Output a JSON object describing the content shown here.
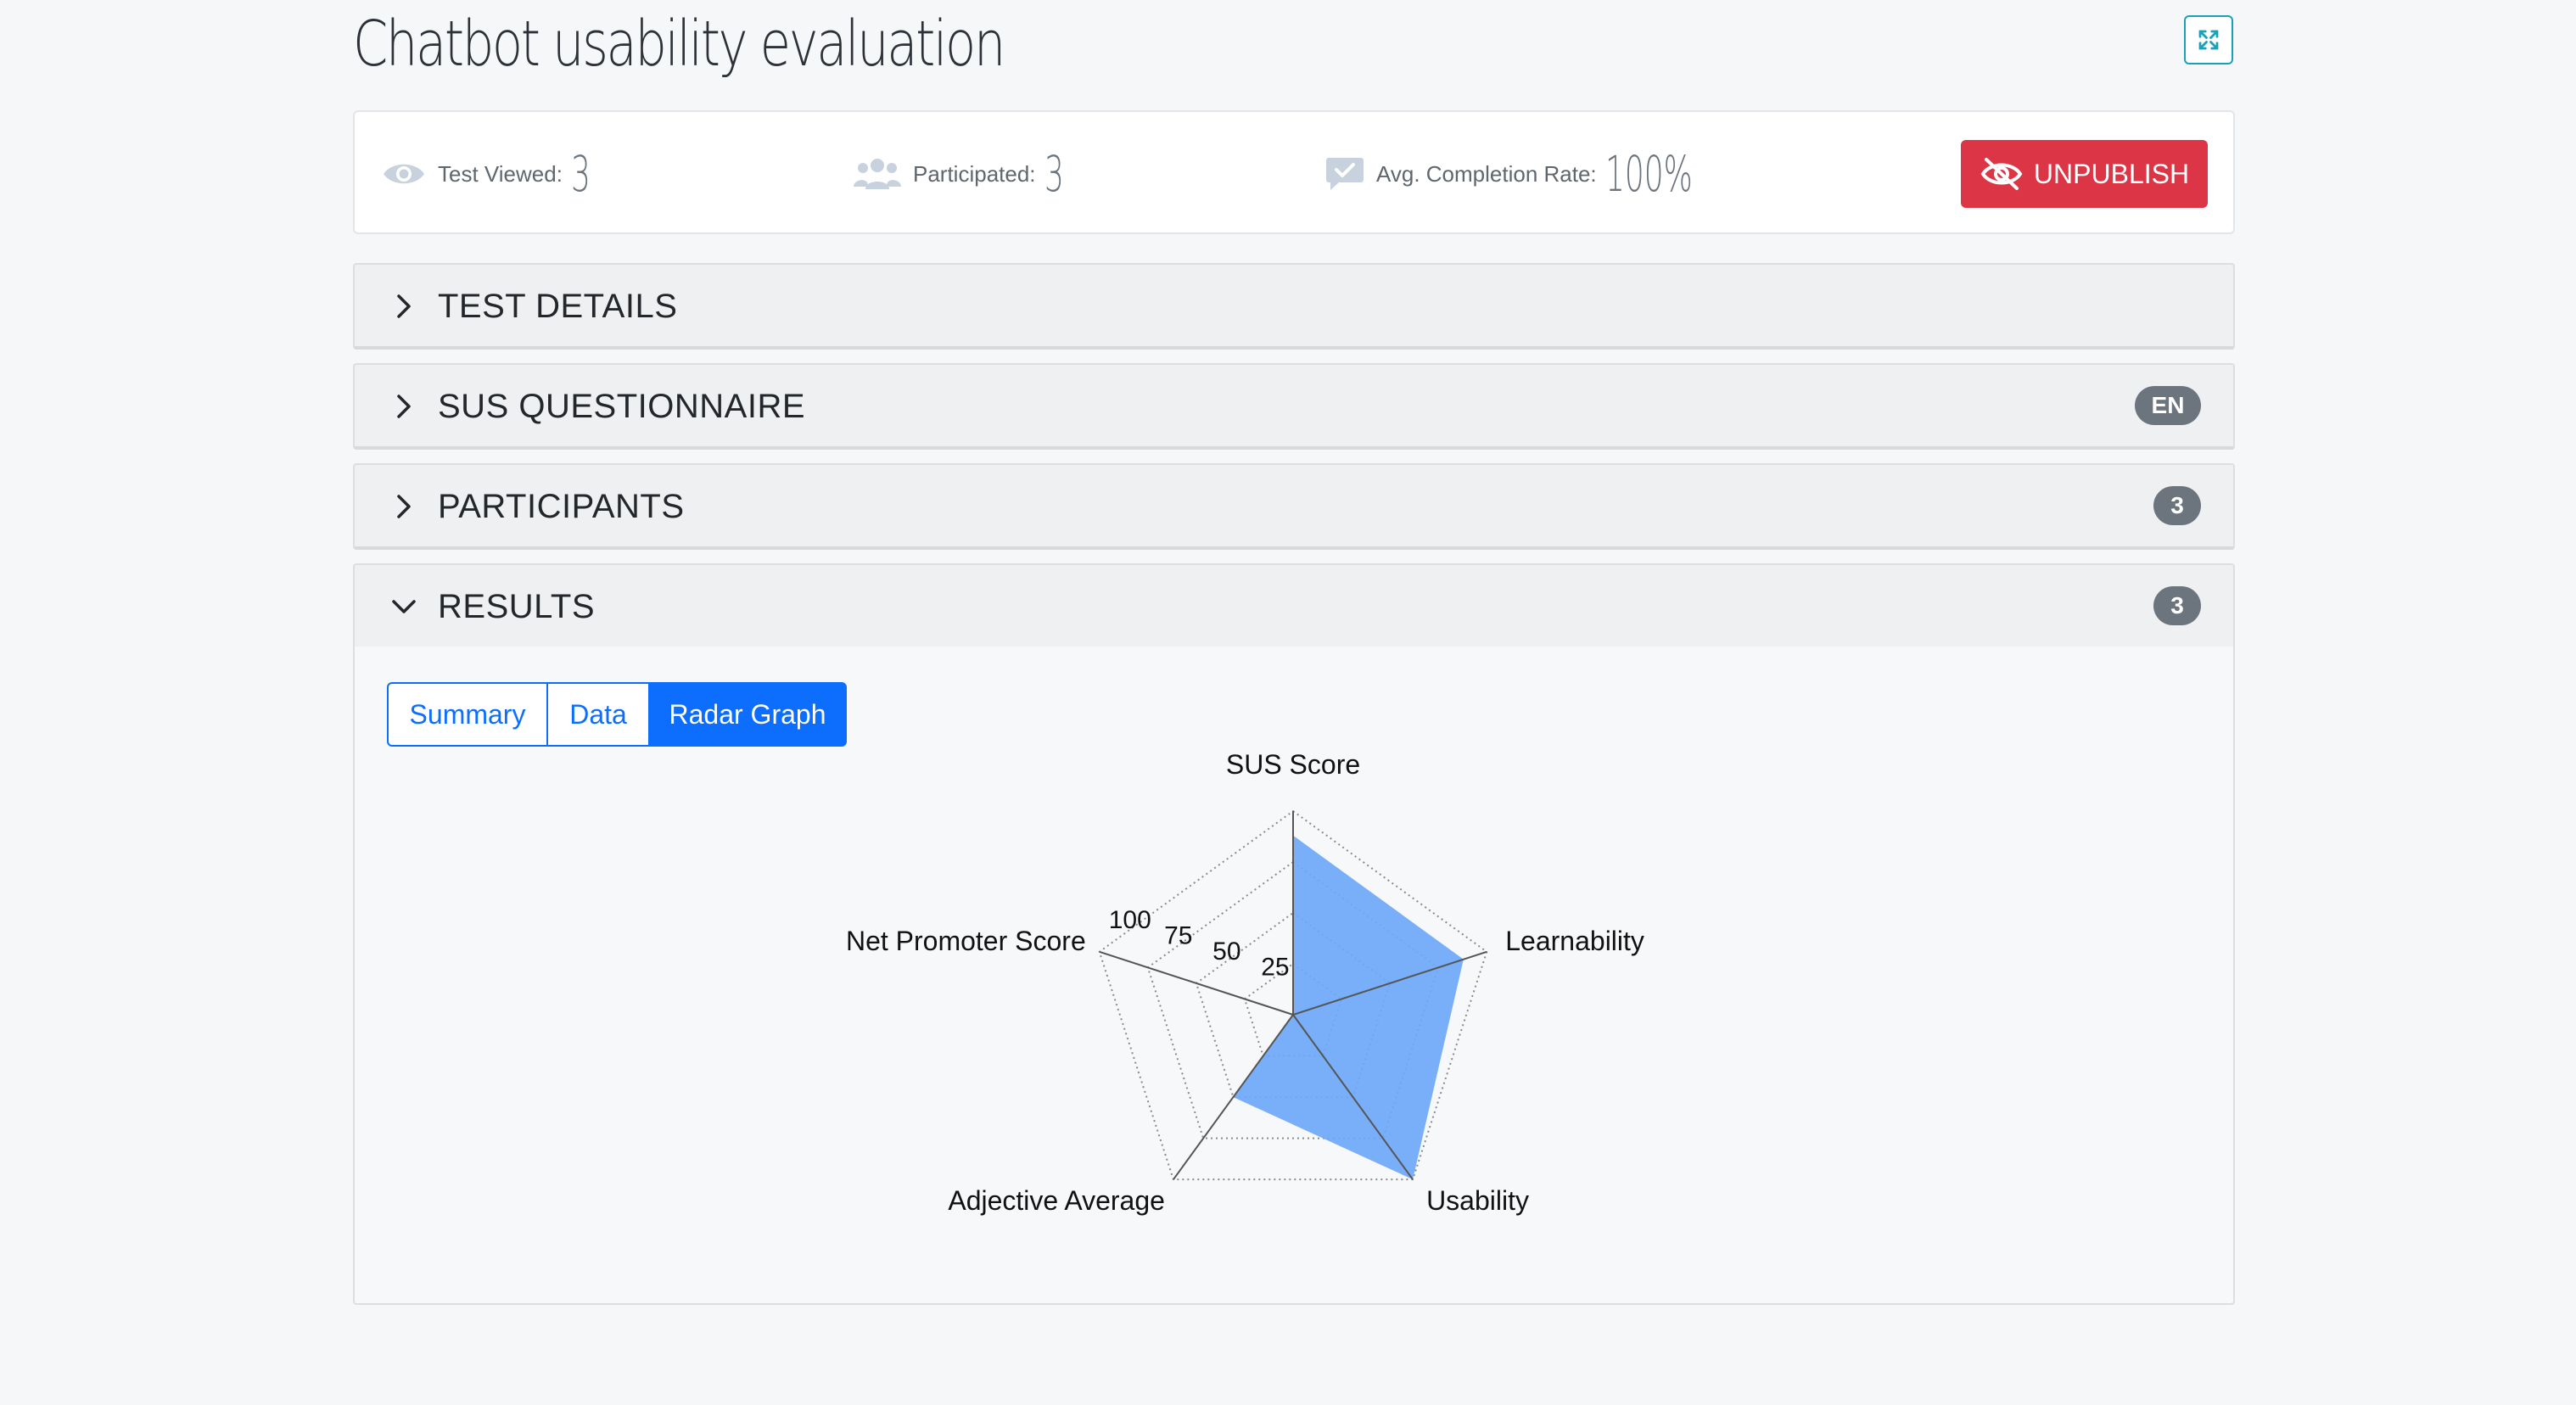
{
  "page": {
    "title": "Chatbot usability evaluation"
  },
  "stats": {
    "viewed_label": "Test Viewed:",
    "viewed_value": "3",
    "participated_label": "Participated:",
    "participated_value": "3",
    "completion_label": "Avg. Completion Rate:",
    "completion_value": "100%",
    "unpublish_label": "UNPUBLISH"
  },
  "sections": {
    "test_details": {
      "title": "TEST DETAILS"
    },
    "sus_questionnaire": {
      "title": "SUS QUESTIONNAIRE",
      "badge": "EN"
    },
    "participants": {
      "title": "PARTICIPANTS",
      "badge": "3"
    },
    "results": {
      "title": "RESULTS",
      "badge": "3"
    }
  },
  "results_tabs": {
    "summary": "Summary",
    "data": "Data",
    "radar": "Radar Graph",
    "active": "Radar Graph"
  },
  "icons": {
    "expand": "expand-icon",
    "viewed": "eye-icon",
    "participated": "users-icon",
    "completion": "comment-check-icon",
    "unpublish": "eye-slash-icon",
    "collapsed": "chevron-right-icon",
    "expanded": "chevron-down-icon"
  },
  "colors": {
    "danger": "#dc3545",
    "primary": "#0d6efd",
    "info": "#17a2b8",
    "badge": "#6c757d",
    "radar_fill": "#6ea7f7"
  },
  "chart_data": {
    "type": "radar",
    "axes": [
      "SUS Score",
      "Learnability",
      "Usability",
      "Adjective Average",
      "Net Promoter Score"
    ],
    "values": [
      88,
      88,
      100,
      50,
      0
    ],
    "ticks": [
      "25",
      "50",
      "75",
      "100"
    ],
    "range": [
      0,
      100
    ],
    "grid": true
  }
}
